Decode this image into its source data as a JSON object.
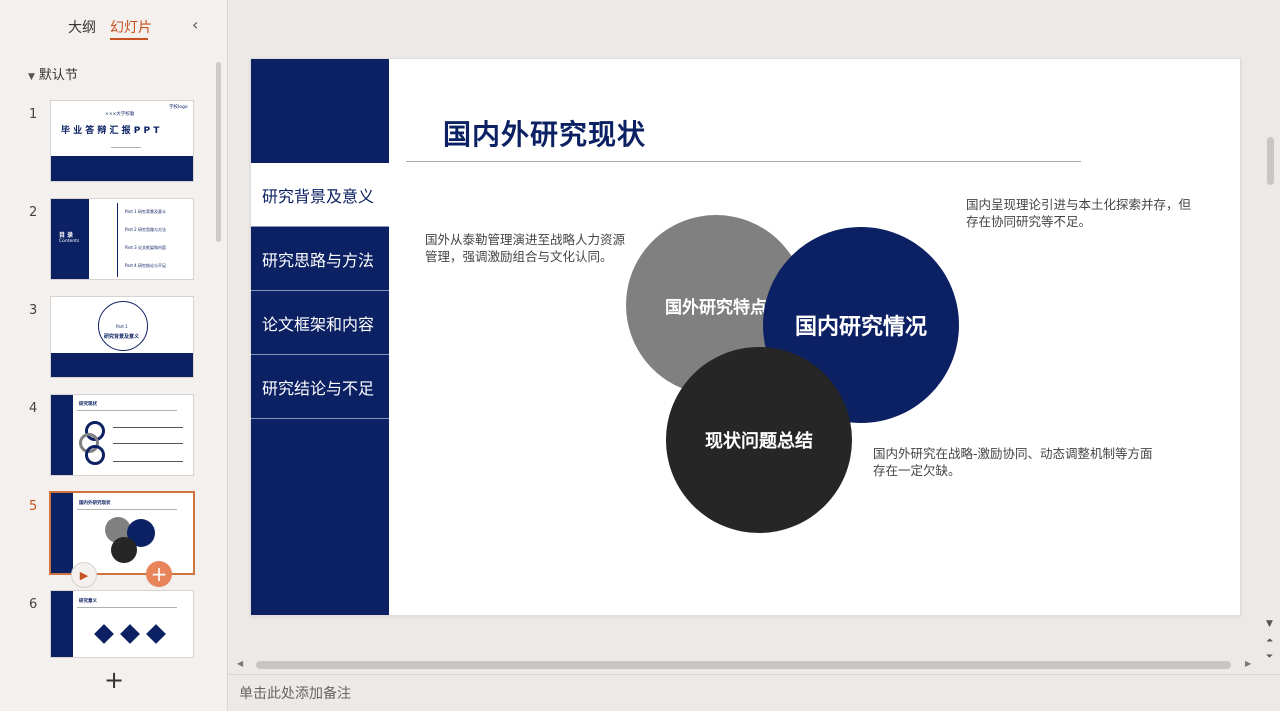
{
  "panel": {
    "tab_outline": "大纲",
    "tab_slides": "幻灯片",
    "section_name": "默认节"
  },
  "thumbnails": [
    {
      "num": "1",
      "title": "毕 业 答 辩 汇 报 P P T",
      "school": "×××大学校徽",
      "logo": "学校logo"
    },
    {
      "num": "2",
      "title": "目 录",
      "subtitle": "Contents",
      "items": [
        "Part 1  研究背景及意义",
        "Part 2  研究思路与方法",
        "Part 3  论文框架和内容",
        "Part 4  研究结论与不足"
      ]
    },
    {
      "num": "3",
      "part": "Part 1",
      "title": "研究背景及意义"
    },
    {
      "num": "4",
      "title": "研究现状"
    },
    {
      "num": "5",
      "title": "国内外研究现状"
    },
    {
      "num": "6",
      "title": "研究意义"
    }
  ],
  "slide": {
    "title": "国内外研究现状",
    "sidebar_tabs": [
      "研究背景及意义",
      "研究思路与方法",
      "论文框架和内容",
      "研究结论与不足"
    ],
    "desc_left": "国外从泰勒管理演进至战略人力资源管理，强调激励组合与文化认同。",
    "desc_top_right": "国内呈现理论引进与本土化探索并存，但存在协同研究等不足。",
    "desc_bottom_right": "国内外研究在战略-激励协同、动态调整机制等方面存在一定欠缺。",
    "circle_foreign": "国外研究特点",
    "circle_domestic": "国内研究情况",
    "circle_summary": "现状问题总结"
  },
  "notes": {
    "placeholder": "单击此处添加备注"
  },
  "colors": {
    "navy": "#0c2163",
    "accent": "#c7511f",
    "gray_circle": "#808080",
    "dark_circle": "#262626"
  }
}
